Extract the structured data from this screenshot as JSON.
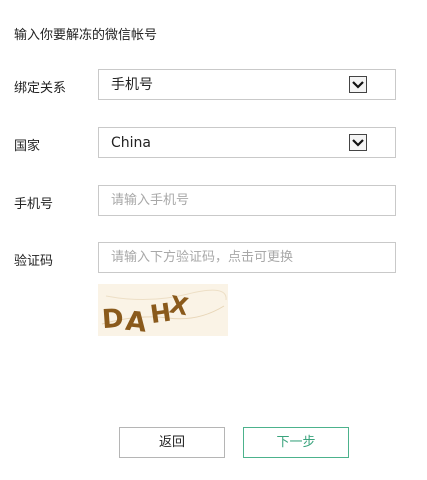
{
  "page_title": "输入你要解冻的微信帐号",
  "form": {
    "binding": {
      "label": "绑定关系",
      "selected": "手机号"
    },
    "country": {
      "label": "国家",
      "selected": "China"
    },
    "phone": {
      "label": "手机号",
      "placeholder": "请输入手机号",
      "value": ""
    },
    "captcha": {
      "label": "验证码",
      "placeholder": "请输入下方验证码，点击可更换",
      "value": "",
      "image_text": "DAHX"
    }
  },
  "buttons": {
    "back_label": "返回",
    "next_label": "下一步"
  },
  "colors": {
    "accent": "#3aa37d",
    "accent_border": "#4cb28c",
    "captcha_text": "#8a5a1c",
    "captcha_bg": "#faf3e6"
  }
}
